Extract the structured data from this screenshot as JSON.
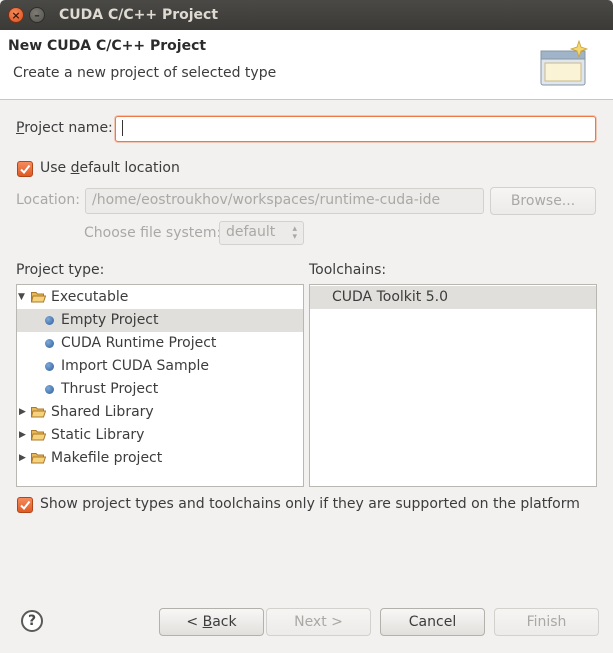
{
  "window": {
    "title": "CUDA C/C++ Project",
    "close_glyph": "×",
    "minimize_glyph": "–"
  },
  "header": {
    "title": "New CUDA C/C++ Project",
    "subtitle": "Create a new project of selected type",
    "icon": "new-project-wizard-banner-icon"
  },
  "project_name": {
    "label_prefix": "P",
    "label_rest": "roject name:",
    "value": ""
  },
  "use_default_location": {
    "label_pre": "Use ",
    "label_accel": "d",
    "label_post": "efault location",
    "checked": true
  },
  "location": {
    "label": "Location:",
    "value": "/home/eostroukhov/workspaces/runtime-cuda-ide",
    "browse_label": "Browse..."
  },
  "file_system": {
    "label": "Choose file system:",
    "value": "default"
  },
  "project_type": {
    "label": "Project type:",
    "items": [
      {
        "label": "Executable",
        "kind": "folder",
        "expanded": true
      },
      {
        "label": "Empty Project",
        "kind": "leaf",
        "selected": true
      },
      {
        "label": "CUDA Runtime Project",
        "kind": "leaf"
      },
      {
        "label": "Import CUDA Sample",
        "kind": "leaf"
      },
      {
        "label": "Thrust Project",
        "kind": "leaf"
      },
      {
        "label": "Shared Library",
        "kind": "folder",
        "expanded": false
      },
      {
        "label": "Static Library",
        "kind": "folder",
        "expanded": false
      },
      {
        "label": "Makefile project",
        "kind": "folder",
        "expanded": false
      }
    ]
  },
  "toolchains": {
    "label": "Toolchains:",
    "items": [
      {
        "label": "CUDA Toolkit 5.0",
        "selected": true
      }
    ]
  },
  "show_supported": {
    "label": "Show project types and toolchains only if they are supported on the platform",
    "checked": true
  },
  "footer": {
    "help_glyph": "?",
    "back_pre": "< ",
    "back_accel": "B",
    "back_post": "ack",
    "next_label": "Next >",
    "cancel_label": "Cancel",
    "finish_label": "Finish"
  },
  "colors": {
    "accent": "#f07746",
    "selection": "#e0dfdc",
    "titlebar": "#3c3b37"
  }
}
